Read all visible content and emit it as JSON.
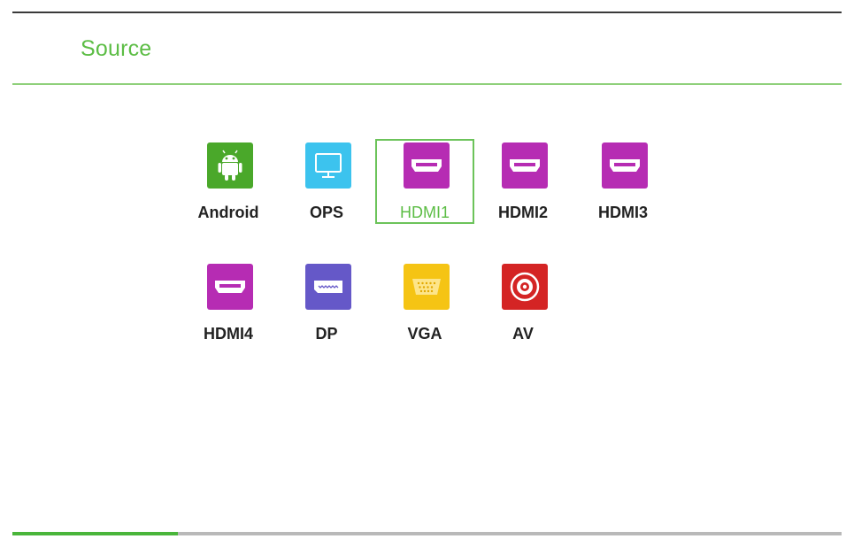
{
  "header": {
    "title": "Source"
  },
  "sources": [
    {
      "label": "Android",
      "icon": "android-icon",
      "color": "#4aa82a",
      "selected": false
    },
    {
      "label": "OPS",
      "icon": "monitor-icon",
      "color": "#3cc3ee",
      "selected": false
    },
    {
      "label": "HDMI1",
      "icon": "hdmi-port-icon",
      "color": "#b62cb3",
      "selected": true
    },
    {
      "label": "HDMI2",
      "icon": "hdmi-port-icon",
      "color": "#b62cb3",
      "selected": false
    },
    {
      "label": "HDMI3",
      "icon": "hdmi-port-icon",
      "color": "#b62cb3",
      "selected": false
    },
    {
      "label": "HDMI4",
      "icon": "hdmi-port-icon",
      "color": "#b62cb3",
      "selected": false
    },
    {
      "label": "DP",
      "icon": "displayport-icon",
      "color": "#6558c8",
      "selected": false
    },
    {
      "label": "VGA",
      "icon": "vga-port-icon",
      "color": "#f5c414",
      "selected": false
    },
    {
      "label": "AV",
      "icon": "av-rca-icon",
      "color": "#d42424",
      "selected": false
    }
  ],
  "progress": {
    "fraction": 0.2
  }
}
